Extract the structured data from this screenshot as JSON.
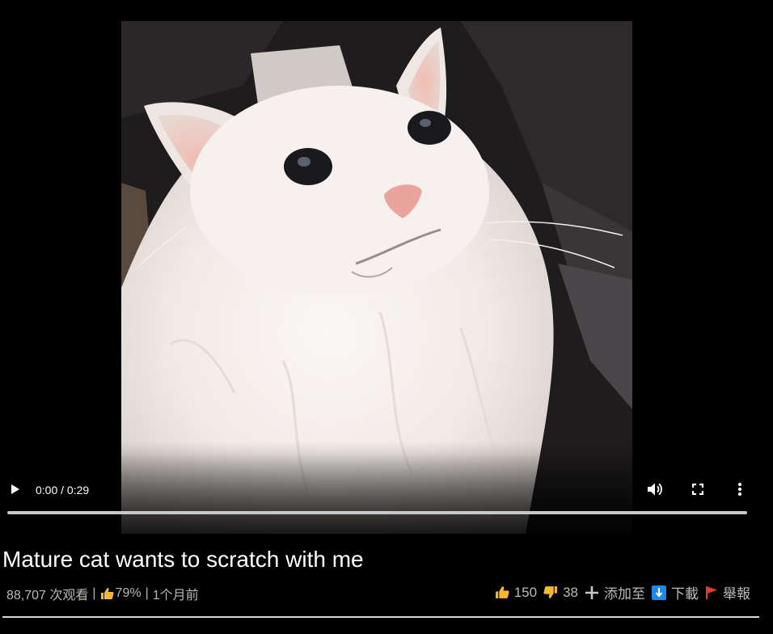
{
  "player": {
    "time_display": "0:00 / 0:29",
    "progress": 0,
    "icons": {
      "play": "play-icon",
      "volume": "volume-icon",
      "fullscreen": "fullscreen-icon",
      "more": "more-vertical-icon"
    }
  },
  "video": {
    "title": "Mature cat wants to scratch with me",
    "views": "88,707 次观看",
    "rating": "79%",
    "age": "1个月前",
    "separator": "|"
  },
  "actions": {
    "likes": "150",
    "dislikes": "38",
    "add_to": "添加至",
    "download": "下載",
    "report": "舉報"
  },
  "colors": {
    "background": "#000000",
    "thumb_yellow": "#f7b731",
    "download_blue": "#1e88e5",
    "report_red": "#e53935",
    "meta_text": "#b9b9b9"
  }
}
